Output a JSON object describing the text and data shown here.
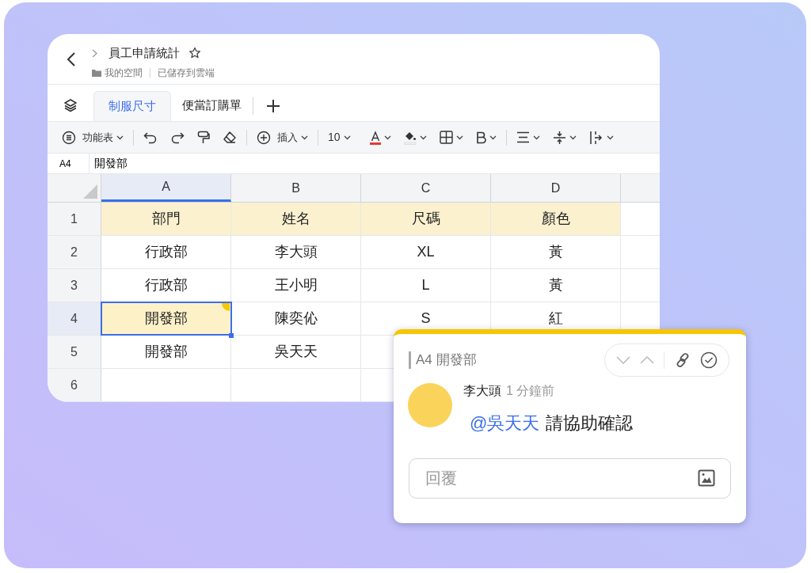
{
  "document": {
    "title": "員工申請統計",
    "starred": false,
    "location": "我的空間",
    "save_status": "已儲存到雲端"
  },
  "sheet_tabs": [
    {
      "label": "制服尺寸",
      "selected": true
    },
    {
      "label": "便當訂購單",
      "selected": false
    }
  ],
  "toolbar": {
    "menu": "功能表",
    "insert": "插入",
    "font_size": "10"
  },
  "formula_bar": {
    "cell": "A4",
    "value": "開發部"
  },
  "grid": {
    "columns": [
      {
        "label": "A",
        "selected": true
      },
      {
        "label": "B",
        "selected": false
      },
      {
        "label": "C",
        "selected": false
      },
      {
        "label": "D",
        "selected": false
      }
    ],
    "rows": [
      {
        "number": "1",
        "kind": "header",
        "selected": false,
        "cells": [
          {
            "text": "部門",
            "selected": false,
            "commented": false
          },
          {
            "text": "姓名",
            "selected": false,
            "commented": false
          },
          {
            "text": "尺碼",
            "selected": false,
            "commented": false
          },
          {
            "text": "顏色",
            "selected": false,
            "commented": false
          }
        ]
      },
      {
        "number": "2",
        "kind": "data",
        "selected": false,
        "cells": [
          {
            "text": "行政部",
            "selected": false,
            "commented": false
          },
          {
            "text": "李大頭",
            "selected": false,
            "commented": false
          },
          {
            "text": "XL",
            "selected": false,
            "commented": false
          },
          {
            "text": "黃",
            "selected": false,
            "commented": false
          }
        ]
      },
      {
        "number": "3",
        "kind": "data",
        "selected": false,
        "cells": [
          {
            "text": "行政部",
            "selected": false,
            "commented": false
          },
          {
            "text": "王小明",
            "selected": false,
            "commented": false
          },
          {
            "text": "L",
            "selected": false,
            "commented": false
          },
          {
            "text": "黃",
            "selected": false,
            "commented": false
          }
        ]
      },
      {
        "number": "4",
        "kind": "data",
        "selected": true,
        "cells": [
          {
            "text": "開發部",
            "selected": true,
            "commented": true
          },
          {
            "text": "陳奕伈",
            "selected": false,
            "commented": false
          },
          {
            "text": "S",
            "selected": false,
            "commented": false
          },
          {
            "text": "紅",
            "selected": false,
            "commented": false
          }
        ]
      },
      {
        "number": "5",
        "kind": "data",
        "selected": false,
        "cells": [
          {
            "text": "開發部",
            "selected": false,
            "commented": false
          },
          {
            "text": "吳天天",
            "selected": false,
            "commented": false
          }
        ]
      },
      {
        "number": "6",
        "kind": "data",
        "selected": false
      }
    ]
  },
  "comment": {
    "cell_ref": "A4 開發部",
    "author": "李大頭",
    "time": "1 分鐘前",
    "mention": "@吳天天",
    "text": "請協助確認",
    "reply_placeholder": "回覆"
  }
}
